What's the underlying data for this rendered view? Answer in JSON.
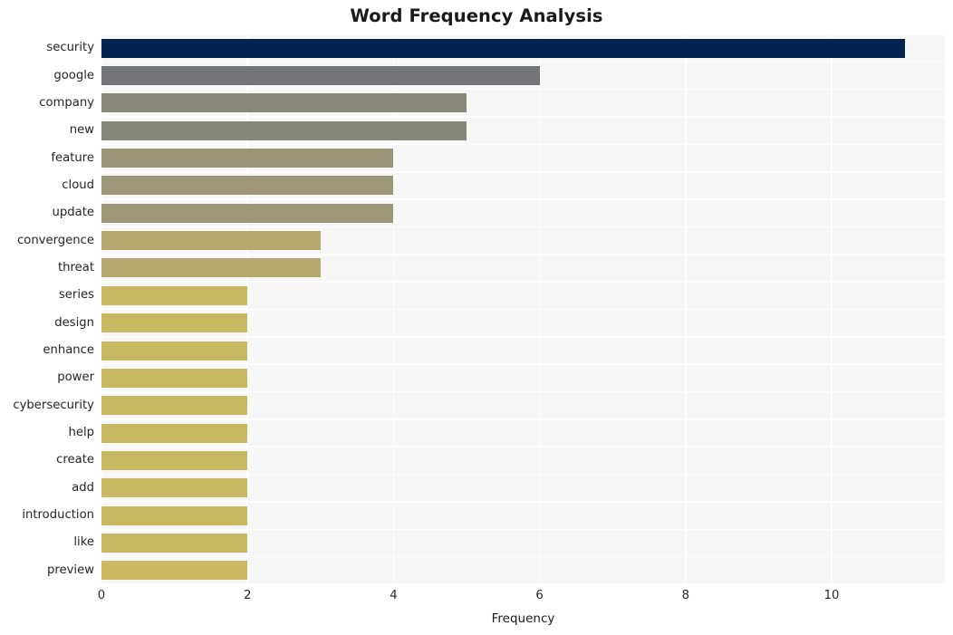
{
  "chart_data": {
    "type": "bar",
    "orientation": "horizontal",
    "title": "Word Frequency Analysis",
    "xlabel": "Frequency",
    "ylabel": "",
    "categories": [
      "security",
      "google",
      "company",
      "new",
      "feature",
      "cloud",
      "update",
      "convergence",
      "threat",
      "series",
      "design",
      "enhance",
      "power",
      "cybersecurity",
      "help",
      "create",
      "add",
      "introduction",
      "like",
      "preview"
    ],
    "values": [
      11,
      6,
      5,
      5,
      4,
      4,
      4,
      3,
      3,
      2,
      2,
      2,
      2,
      2,
      2,
      2,
      2,
      2,
      2,
      2
    ],
    "bar_colors": [
      "#042350",
      "#727477",
      "#888778",
      "#868678",
      "#9b9577",
      "#9d9677",
      "#9d9677",
      "#b3a86e",
      "#b3a86e",
      "#c9b862",
      "#c9b862",
      "#c9b862",
      "#c9b862",
      "#c9b862",
      "#c9b862",
      "#c9b862",
      "#c9b862",
      "#c9b862",
      "#c9b862",
      "#ccb860"
    ],
    "xlim": [
      0,
      11.55
    ],
    "ylim": [
      -0.6,
      19.6
    ],
    "xticks": [
      0,
      2,
      4,
      6,
      8,
      10
    ],
    "xtick_labels": [
      "0",
      "2",
      "4",
      "6",
      "8",
      "10"
    ],
    "grid": true,
    "grid_color": "#ffffff",
    "plot_background": "#f7f7f7",
    "figure_background": "#ffffff",
    "legend": null,
    "legend_position": "none"
  }
}
